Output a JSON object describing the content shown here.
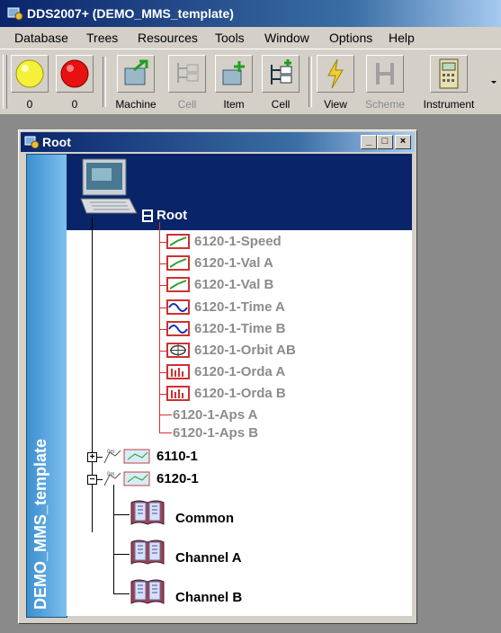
{
  "app": {
    "title": "DDS2007+ (DEMO_MMS_template)"
  },
  "menu": {
    "database": "Database",
    "trees": "Trees",
    "resources": "Resources",
    "tools": "Tools",
    "window": "Window",
    "options": "Options",
    "help": "Help"
  },
  "toolbar": {
    "yellow_count": "0",
    "red_count": "0",
    "machine": "Machine",
    "cell_disabled": "Cell",
    "item": "Item",
    "cell": "Cell",
    "view": "View",
    "scheme": "Scheme",
    "instrument": "Instrument"
  },
  "window": {
    "title": "Root",
    "side_label": "DEMO_MMS_template",
    "buttons": {
      "minimize": "_",
      "maximize": "□",
      "close": "×"
    }
  },
  "tree": {
    "root_label": "Root",
    "channels": [
      {
        "label": "6120-1-Speed",
        "icon": "trend-icon"
      },
      {
        "label": "6120-1-Val A",
        "icon": "trend-icon"
      },
      {
        "label": "6120-1-Val B",
        "icon": "trend-icon"
      },
      {
        "label": "6120-1-Time A",
        "icon": "waveform-icon"
      },
      {
        "label": "6120-1-Time B",
        "icon": "waveform-icon"
      },
      {
        "label": "6120-1-Orbit AB",
        "icon": "orbit-icon"
      },
      {
        "label": "6120-1-Orda A",
        "icon": "spectrum-icon"
      },
      {
        "label": "6120-1-Orda B",
        "icon": "spectrum-icon"
      },
      {
        "label": "6120-1-Aps A",
        "icon": ""
      },
      {
        "label": "6120-1-Aps B",
        "icon": ""
      }
    ],
    "machines": [
      {
        "label": "6110-1",
        "expander": "+"
      },
      {
        "label": "6120-1",
        "expander": "−"
      }
    ],
    "groups": [
      {
        "label": "Common"
      },
      {
        "label": "Channel A"
      },
      {
        "label": "Channel B"
      }
    ]
  },
  "colors": {
    "title_start": "#0a246a",
    "title_end": "#a6caf0",
    "desktop": "#8a8a8a",
    "side_panel": "#3b8fd0",
    "tree_line_red": "#d83030",
    "dimmed_text": "#8c8c8c"
  }
}
